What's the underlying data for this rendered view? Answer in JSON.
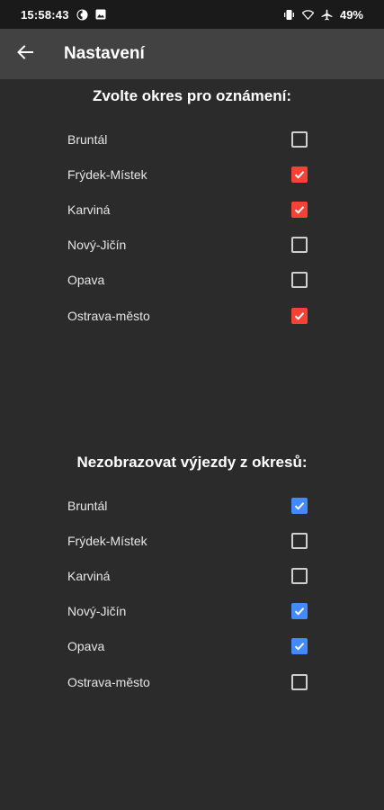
{
  "status_bar": {
    "time": "15:58:43",
    "battery_percent": "49%",
    "left_icons": [
      "sync-icon",
      "image-icon"
    ],
    "right_icons": [
      "vibrate-icon",
      "wifi-icon",
      "airplane-icon"
    ]
  },
  "app_bar": {
    "title": "Nastavení",
    "back_icon": "arrow-left-icon"
  },
  "colors": {
    "background": "#2b2b2b",
    "app_bar": "#424242",
    "status_bar": "#1a1a1a",
    "checked_notify": "#f44336",
    "checked_hide": "#448aff"
  },
  "notify_section": {
    "heading": "Zvolte okres pro oznámení:",
    "items": [
      {
        "label": "Bruntál",
        "checked": false
      },
      {
        "label": "Frýdek-Místek",
        "checked": true
      },
      {
        "label": "Karviná",
        "checked": true
      },
      {
        "label": "Nový-Jičín",
        "checked": false
      },
      {
        "label": "Opava",
        "checked": false
      },
      {
        "label": "Ostrava-město",
        "checked": true
      }
    ]
  },
  "hide_section": {
    "heading": "Nezobrazovat výjezdy z okresů:",
    "items": [
      {
        "label": "Bruntál",
        "checked": true
      },
      {
        "label": "Frýdek-Místek",
        "checked": false
      },
      {
        "label": "Karviná",
        "checked": false
      },
      {
        "label": "Nový-Jičín",
        "checked": true
      },
      {
        "label": "Opava",
        "checked": true
      },
      {
        "label": "Ostrava-město",
        "checked": false
      }
    ]
  }
}
